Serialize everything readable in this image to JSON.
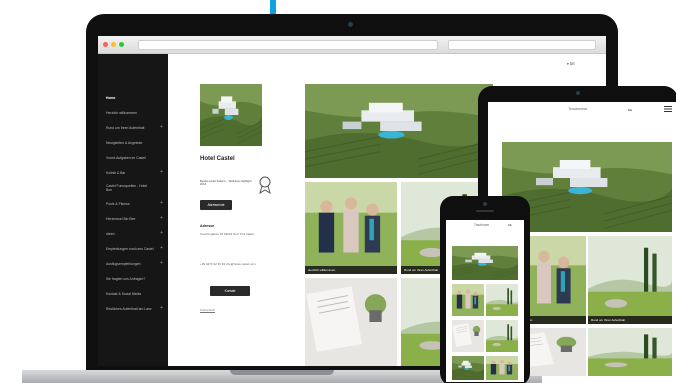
{
  "laptop": {
    "sidebar": {
      "items": [
        {
          "label": "Home",
          "has_plus": false,
          "active": true
        },
        {
          "label": "Herzlich willkommen",
          "has_plus": false,
          "active": false
        },
        {
          "label": "Rund um Ihren Aufenthalt",
          "has_plus": true,
          "active": false
        },
        {
          "label": "Neuigkeiten & Angebote",
          "has_plus": false,
          "active": false
        },
        {
          "label": "Vorort-Aufgaben im Castel",
          "has_plus": false,
          "active": false
        },
        {
          "label": "Kulinik & Bar",
          "has_plus": true,
          "active": false
        },
        {
          "label": "Castel Fumoquellen - Hotel Bon",
          "has_plus": false,
          "active": false
        },
        {
          "label": "Pools & Fitness",
          "has_plus": true,
          "active": false
        },
        {
          "label": "Herzensort Bio Bee",
          "has_plus": true,
          "active": false
        },
        {
          "label": "Ideen",
          "has_plus": true,
          "active": false
        },
        {
          "label": "Empfehlungen rund ums Castel",
          "has_plus": true,
          "active": false
        },
        {
          "label": "Ausflugsempfehlungen",
          "has_plus": true,
          "active": false
        },
        {
          "label": "Sie fragten uns Anfragen?",
          "has_plus": false,
          "active": false
        },
        {
          "label": "Kontakt & Social Media",
          "has_plus": false,
          "active": false
        },
        {
          "label": "Restliches Aufenthalt am Lanz",
          "has_plus": true,
          "active": false
        }
      ]
    },
    "info": {
      "hotel_name": "Hotel Castel",
      "badge_text": "Bestes Hotel Italiens – Wellness Highlight 2014",
      "button_primary": "Abreisenote",
      "address_heading": "Adresse",
      "address_lines": "Keschtngasse 18 39019 Dorf Tirol Italien",
      "contact_lines": "+39 0473 92 36 93 info@hotel-castel.com",
      "button_secondary": "Kontakt",
      "more_link": "Telefonbuch"
    },
    "content": {
      "language": "▾ DE",
      "tiles": [
        {
          "caption": "Herzlich willkommen"
        },
        {
          "caption": "Rund um Ihren Aufenthalt"
        }
      ]
    }
  },
  "tablet": {
    "logo": "Trautmann",
    "language": "DE",
    "tiles": [
      {
        "caption": "Herzlich willkommen"
      },
      {
        "caption": "Rund um Ihren Aufenthalt"
      }
    ]
  },
  "phone": {
    "logo": "Trautmann",
    "language": "DE"
  },
  "colors": {
    "accent": "#12a2e0",
    "sidebar_bg": "#161616",
    "button_bg": "#2a2a2a",
    "device_frame": "#0f0f10"
  }
}
